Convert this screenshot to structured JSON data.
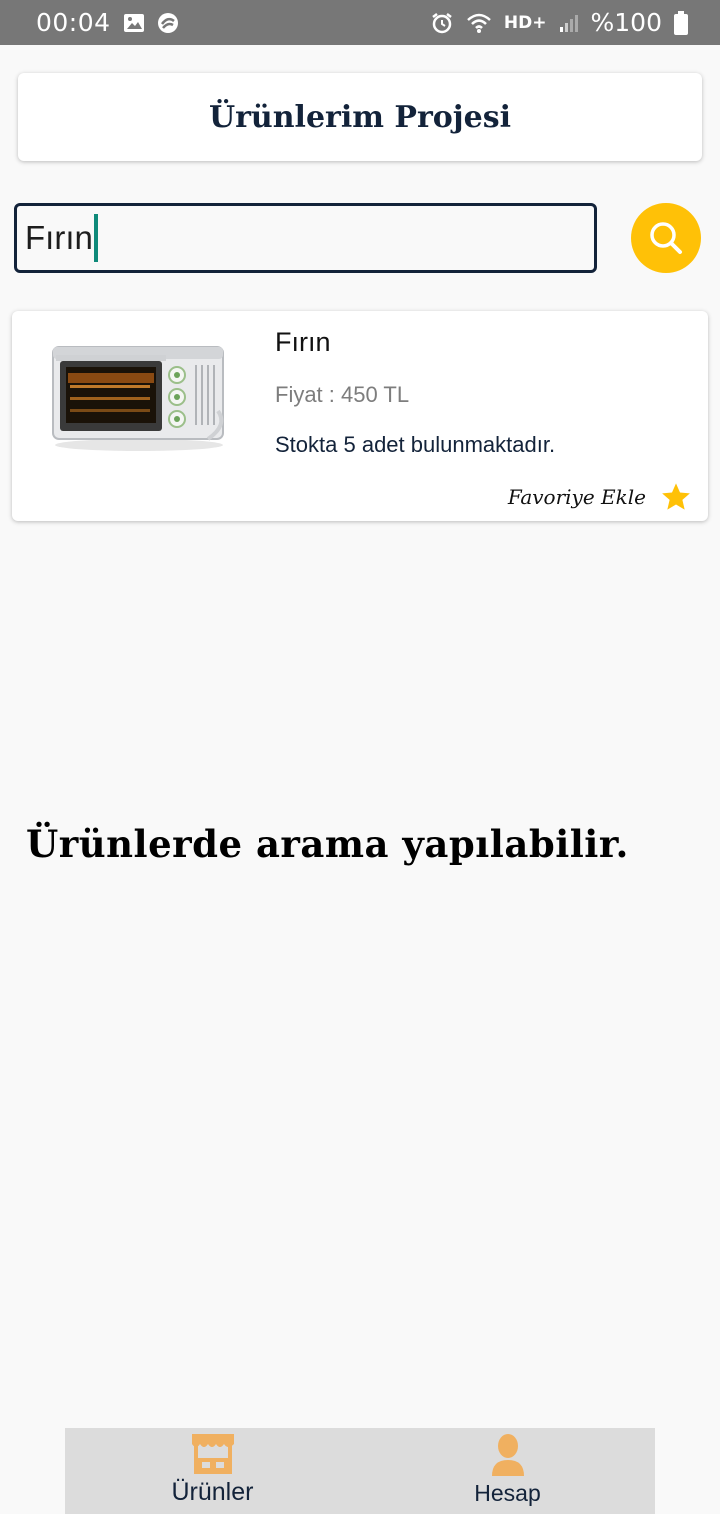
{
  "status_bar": {
    "time": "00:04",
    "network": "HD+",
    "battery": "%100"
  },
  "header": {
    "title": "Ürünlerim Projesi"
  },
  "search": {
    "value": "Fırın",
    "icon": "search-icon"
  },
  "products": [
    {
      "name": "Fırın",
      "price": "Fiyat : 450 TL",
      "stock": "Stokta 5 adet bulunmaktadır.",
      "favorite_label": "Favoriye Ekle",
      "favorite_icon": "star-icon",
      "image": "oven-image"
    }
  ],
  "info_message": "Ürünlerde arama yapılabilir.",
  "bottom_nav": [
    {
      "label": "Ürünler",
      "icon": "store-icon"
    },
    {
      "label": "Hesap",
      "icon": "person-icon"
    }
  ],
  "colors": {
    "accent": "#ffc107",
    "primary_text": "#13233a",
    "nav_icon": "#f0b060",
    "status_bar": "#777777"
  }
}
